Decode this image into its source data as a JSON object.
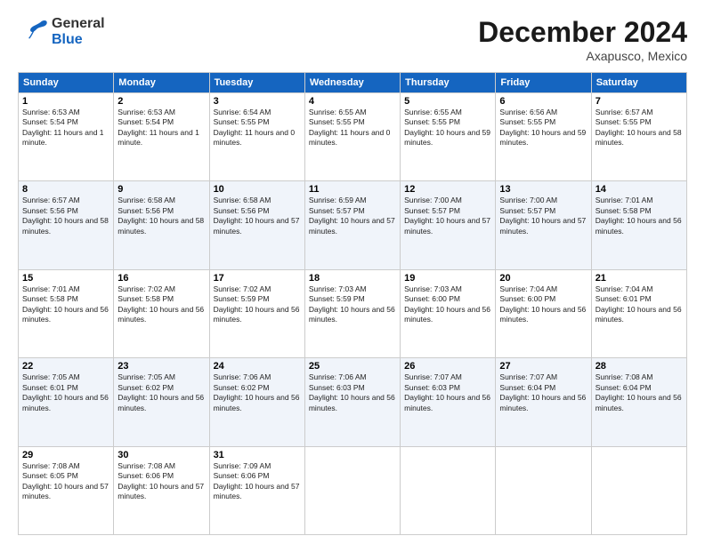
{
  "header": {
    "logo_general": "General",
    "logo_blue": "Blue",
    "month_title": "December 2024",
    "location": "Axapusco, Mexico"
  },
  "days_of_week": [
    "Sunday",
    "Monday",
    "Tuesday",
    "Wednesday",
    "Thursday",
    "Friday",
    "Saturday"
  ],
  "weeks": [
    [
      {
        "day": "1",
        "sunrise": "6:53 AM",
        "sunset": "5:54 PM",
        "daylight": "11 hours and 1 minute."
      },
      {
        "day": "2",
        "sunrise": "6:53 AM",
        "sunset": "5:54 PM",
        "daylight": "11 hours and 1 minute."
      },
      {
        "day": "3",
        "sunrise": "6:54 AM",
        "sunset": "5:55 PM",
        "daylight": "11 hours and 0 minutes."
      },
      {
        "day": "4",
        "sunrise": "6:55 AM",
        "sunset": "5:55 PM",
        "daylight": "11 hours and 0 minutes."
      },
      {
        "day": "5",
        "sunrise": "6:55 AM",
        "sunset": "5:55 PM",
        "daylight": "10 hours and 59 minutes."
      },
      {
        "day": "6",
        "sunrise": "6:56 AM",
        "sunset": "5:55 PM",
        "daylight": "10 hours and 59 minutes."
      },
      {
        "day": "7",
        "sunrise": "6:57 AM",
        "sunset": "5:55 PM",
        "daylight": "10 hours and 58 minutes."
      }
    ],
    [
      {
        "day": "8",
        "sunrise": "6:57 AM",
        "sunset": "5:56 PM",
        "daylight": "10 hours and 58 minutes."
      },
      {
        "day": "9",
        "sunrise": "6:58 AM",
        "sunset": "5:56 PM",
        "daylight": "10 hours and 58 minutes."
      },
      {
        "day": "10",
        "sunrise": "6:58 AM",
        "sunset": "5:56 PM",
        "daylight": "10 hours and 57 minutes."
      },
      {
        "day": "11",
        "sunrise": "6:59 AM",
        "sunset": "5:57 PM",
        "daylight": "10 hours and 57 minutes."
      },
      {
        "day": "12",
        "sunrise": "7:00 AM",
        "sunset": "5:57 PM",
        "daylight": "10 hours and 57 minutes."
      },
      {
        "day": "13",
        "sunrise": "7:00 AM",
        "sunset": "5:57 PM",
        "daylight": "10 hours and 57 minutes."
      },
      {
        "day": "14",
        "sunrise": "7:01 AM",
        "sunset": "5:58 PM",
        "daylight": "10 hours and 56 minutes."
      }
    ],
    [
      {
        "day": "15",
        "sunrise": "7:01 AM",
        "sunset": "5:58 PM",
        "daylight": "10 hours and 56 minutes."
      },
      {
        "day": "16",
        "sunrise": "7:02 AM",
        "sunset": "5:58 PM",
        "daylight": "10 hours and 56 minutes."
      },
      {
        "day": "17",
        "sunrise": "7:02 AM",
        "sunset": "5:59 PM",
        "daylight": "10 hours and 56 minutes."
      },
      {
        "day": "18",
        "sunrise": "7:03 AM",
        "sunset": "5:59 PM",
        "daylight": "10 hours and 56 minutes."
      },
      {
        "day": "19",
        "sunrise": "7:03 AM",
        "sunset": "6:00 PM",
        "daylight": "10 hours and 56 minutes."
      },
      {
        "day": "20",
        "sunrise": "7:04 AM",
        "sunset": "6:00 PM",
        "daylight": "10 hours and 56 minutes."
      },
      {
        "day": "21",
        "sunrise": "7:04 AM",
        "sunset": "6:01 PM",
        "daylight": "10 hours and 56 minutes."
      }
    ],
    [
      {
        "day": "22",
        "sunrise": "7:05 AM",
        "sunset": "6:01 PM",
        "daylight": "10 hours and 56 minutes."
      },
      {
        "day": "23",
        "sunrise": "7:05 AM",
        "sunset": "6:02 PM",
        "daylight": "10 hours and 56 minutes."
      },
      {
        "day": "24",
        "sunrise": "7:06 AM",
        "sunset": "6:02 PM",
        "daylight": "10 hours and 56 minutes."
      },
      {
        "day": "25",
        "sunrise": "7:06 AM",
        "sunset": "6:03 PM",
        "daylight": "10 hours and 56 minutes."
      },
      {
        "day": "26",
        "sunrise": "7:07 AM",
        "sunset": "6:03 PM",
        "daylight": "10 hours and 56 minutes."
      },
      {
        "day": "27",
        "sunrise": "7:07 AM",
        "sunset": "6:04 PM",
        "daylight": "10 hours and 56 minutes."
      },
      {
        "day": "28",
        "sunrise": "7:08 AM",
        "sunset": "6:04 PM",
        "daylight": "10 hours and 56 minutes."
      }
    ],
    [
      {
        "day": "29",
        "sunrise": "7:08 AM",
        "sunset": "6:05 PM",
        "daylight": "10 hours and 57 minutes."
      },
      {
        "day": "30",
        "sunrise": "7:08 AM",
        "sunset": "6:06 PM",
        "daylight": "10 hours and 57 minutes."
      },
      {
        "day": "31",
        "sunrise": "7:09 AM",
        "sunset": "6:06 PM",
        "daylight": "10 hours and 57 minutes."
      },
      null,
      null,
      null,
      null
    ]
  ],
  "labels": {
    "sunrise": "Sunrise:",
    "sunset": "Sunset:",
    "daylight": "Daylight:"
  }
}
